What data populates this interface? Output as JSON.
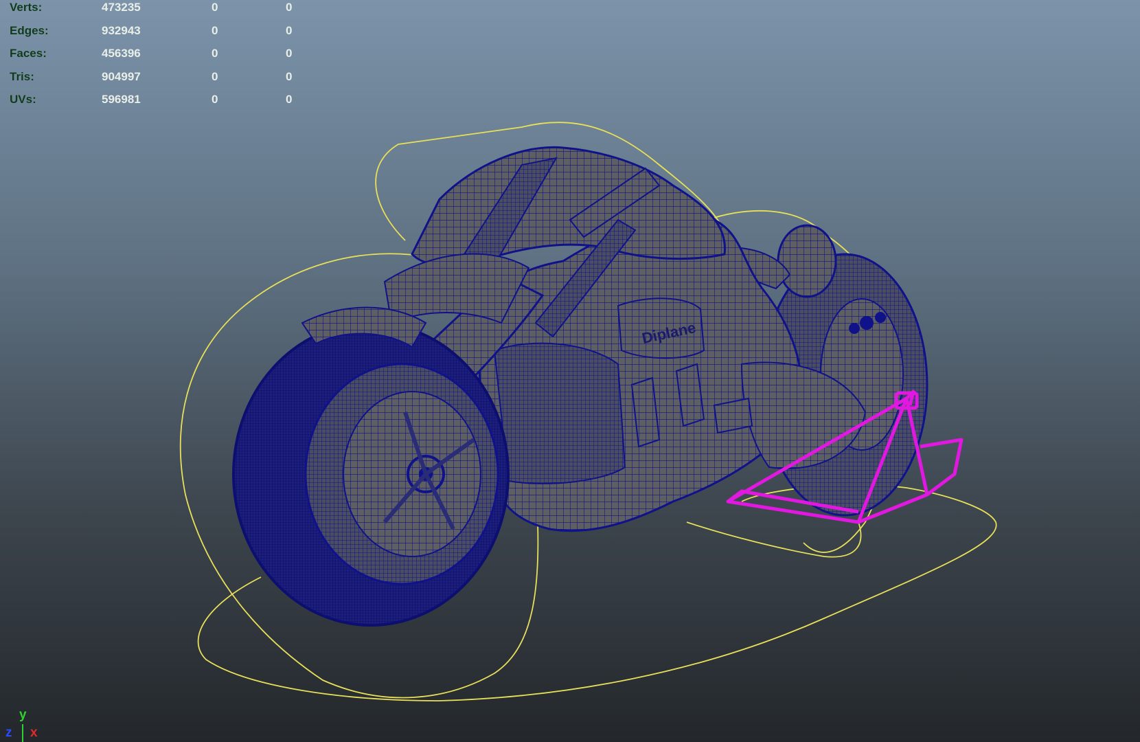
{
  "hud": {
    "rows": [
      {
        "label": "Verts:",
        "c1": "473235",
        "c2": "0",
        "c3": "0"
      },
      {
        "label": "Edges:",
        "c1": "932943",
        "c2": "0",
        "c3": "0"
      },
      {
        "label": "Faces:",
        "c1": "456396",
        "c2": "0",
        "c3": "0"
      },
      {
        "label": "Tris:",
        "c1": "904997",
        "c2": "0",
        "c3": "0"
      },
      {
        "label": "UVs:",
        "c1": "596981",
        "c2": "0",
        "c3": "0"
      }
    ]
  },
  "model": {
    "badge_text": "Diplane",
    "wire_color": "#10128a",
    "body_color": "#5d5f62",
    "control_curve_color": "#e8e05a",
    "stand_color": "#e018e0"
  },
  "axis_gizmo": {
    "y": "y",
    "z": "z",
    "x": "x"
  }
}
